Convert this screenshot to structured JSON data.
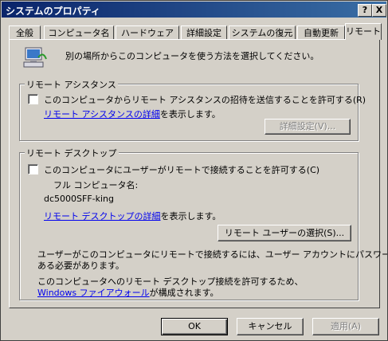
{
  "window": {
    "title": "システムのプロパティ",
    "help_label": "?",
    "close_label": "X"
  },
  "tabs": [
    {
      "label": "全般"
    },
    {
      "label": "コンピュータ名"
    },
    {
      "label": "ハードウェア"
    },
    {
      "label": "詳細設定"
    },
    {
      "label": "システムの復元"
    },
    {
      "label": "自動更新"
    },
    {
      "label": "リモート"
    }
  ],
  "intro": {
    "text": "別の場所からこのコンピュータを使う方法を選択してください。",
    "icon": "remote-computer-icon"
  },
  "assistance": {
    "group_label": "リモート アシスタンス",
    "checkbox_label": "このコンピュータからリモート アシスタンスの招待を送信することを許可する(R)",
    "checked": false,
    "link_text": "リモート アシスタンスの詳細",
    "link_suffix": "を表示します。",
    "advanced_button": "詳細設定(V)..."
  },
  "desktop": {
    "group_label": "リモート デスクトップ",
    "checkbox_label": "このコンピュータにユーザーがリモートで接続することを許可する(C)",
    "checked": false,
    "computer_name_label": "フル コンピュータ名:",
    "computer_name": "dc5000SFF-king",
    "link_text": "リモート デスクトップの詳細",
    "link_suffix": "を表示します。",
    "select_users_button": "リモート ユーザーの選択(S)...",
    "note_line1": "ユーザーがこのコンピュータにリモートで接続するには、ユーザー アカウントにパスワードが",
    "note_line2": "ある必要があります。",
    "firewall_line1": "このコンピュータへのリモート デスクトップ接続を許可するため、",
    "firewall_link": "Windows ファイアウォール",
    "firewall_suffix": "が構成されます。"
  },
  "buttons": {
    "ok": "OK",
    "cancel": "キャンセル",
    "apply": "適用(A)"
  }
}
